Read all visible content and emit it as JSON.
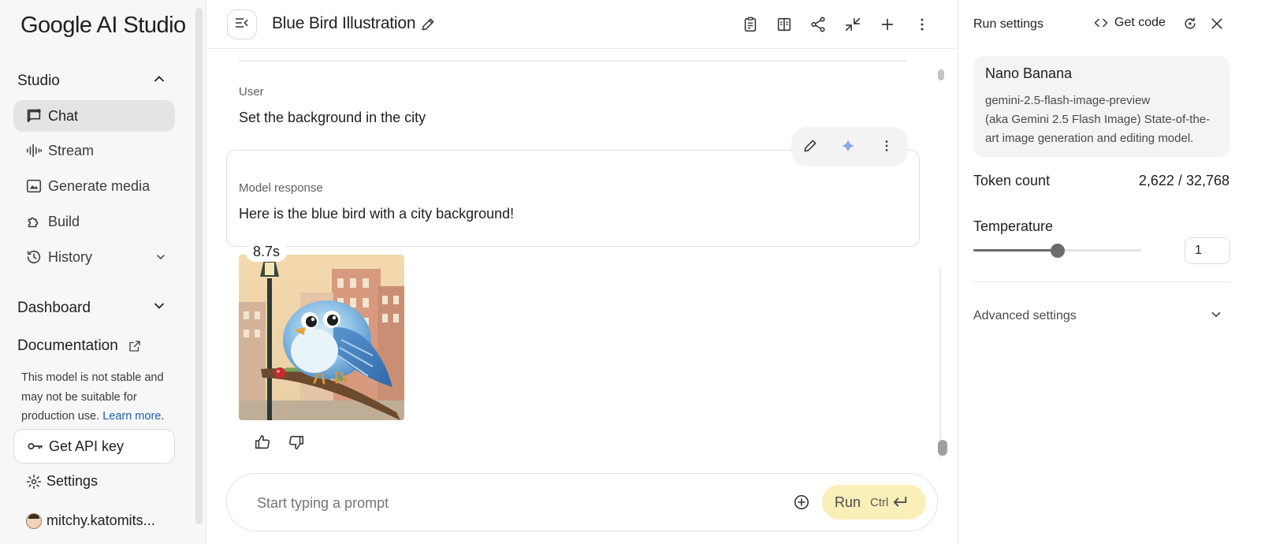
{
  "app": {
    "logo_text": "Google AI Studio"
  },
  "sidebar": {
    "studio_label": "Studio",
    "items": [
      {
        "label": "Chat",
        "icon": "chat-icon",
        "active": true
      },
      {
        "label": "Stream",
        "icon": "stream-icon"
      },
      {
        "label": "Generate media",
        "icon": "image-icon"
      },
      {
        "label": "Build",
        "icon": "build-icon"
      },
      {
        "label": "History",
        "icon": "history-icon"
      }
    ],
    "dashboard_label": "Dashboard",
    "documentation_label": "Documentation",
    "notice_text": "This model is not stable and may not be suitable for production use.",
    "learn_more": "Learn more",
    "api_key_label": "Get API key",
    "settings_label": "Settings",
    "user_label": "mitchy.katomits..."
  },
  "header": {
    "title": "Blue Bird Illustration"
  },
  "chat": {
    "user_role": "User",
    "user_message": "Set the background in the city",
    "model_role": "Model response",
    "model_message": "Here is the blue bird with a city background!",
    "elapsed": "8.7s"
  },
  "prompt": {
    "placeholder": "Start typing a prompt",
    "run_label": "Run",
    "run_shortcut": "Ctrl"
  },
  "run_settings": {
    "title": "Run settings",
    "get_code": "Get code",
    "model_name": "Nano Banana",
    "model_id": "gemini-2.5-flash-image-preview",
    "model_desc": "(aka Gemini 2.5 Flash Image) State-of-the-art image generation and editing model.",
    "token_label": "Token count",
    "token_value": "2,622 / 32,768",
    "temperature_label": "Temperature",
    "temperature_value": "1",
    "temperature_fraction": 0.5,
    "advanced_label": "Advanced settings"
  },
  "colors": {
    "run_button": "#fbefb8",
    "active_nav": "#e4e4e4",
    "link": "#1a5fb4",
    "sparkle": "#8aa8f0"
  }
}
